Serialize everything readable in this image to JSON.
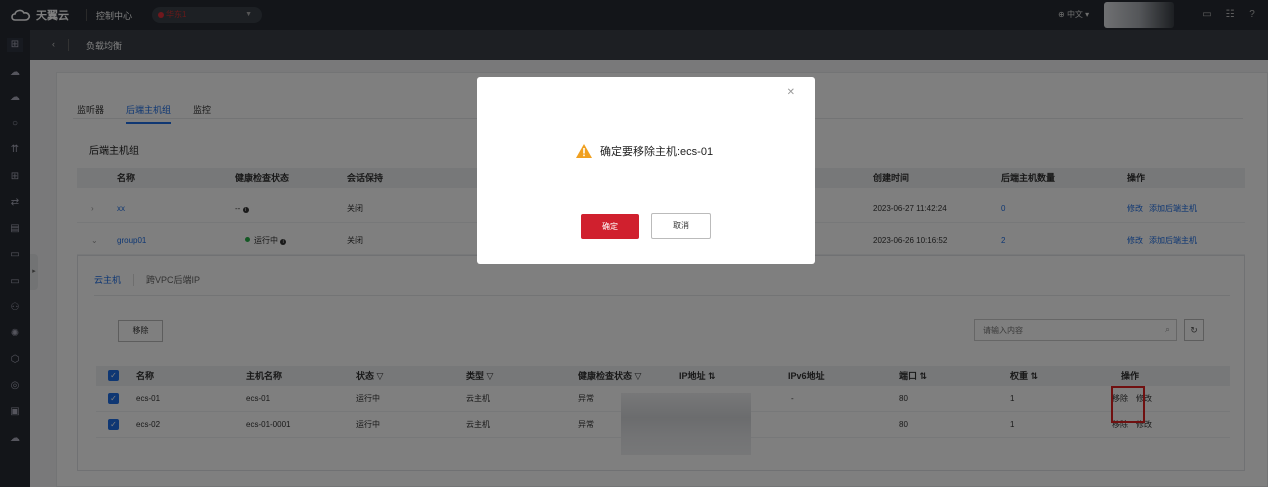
{
  "topbar": {
    "brand": "天翼云",
    "console": "控制中心",
    "region": "华东1",
    "lang": "中文"
  },
  "subbar": {
    "title": "负载均衡"
  },
  "tabs": [
    "监听器",
    "后端主机组",
    "监控"
  ],
  "section_title": "后端主机组",
  "group_table": {
    "headers": [
      "名称",
      "健康检查状态",
      "会话保持",
      "创建时间",
      "后端主机数量",
      "操作"
    ],
    "rows": [
      {
        "name": "xx",
        "health": "--",
        "session": "关闭",
        "created": "2023-06-27 11:42:24",
        "count": "0",
        "action1": "修改",
        "action2": "添加后端主机"
      },
      {
        "name": "group01",
        "health": "运行中",
        "session": "关闭",
        "created": "2023-06-26 10:16:52",
        "count": "2",
        "action1": "修改",
        "action2": "添加后端主机"
      }
    ]
  },
  "subtabs": [
    "云主机",
    "跨VPC后端IP"
  ],
  "remove_button": "移除",
  "search_placeholder": "请输入内容",
  "host_table": {
    "headers": [
      "名称",
      "主机名称",
      "状态",
      "类型",
      "健康检查状态",
      "IP地址",
      "IPv6地址",
      "端口",
      "权重",
      "操作"
    ],
    "rows": [
      {
        "name": "ecs-01",
        "host": "ecs-01",
        "state": "运行中",
        "type": "云主机",
        "health": "异常",
        "ipv6": "-",
        "port": "80",
        "weight": "1",
        "act1": "移除",
        "act2": "修改"
      },
      {
        "name": "ecs-02",
        "host": "ecs-01-0001",
        "state": "运行中",
        "type": "云主机",
        "health": "异常",
        "ipv6": "",
        "port": "80",
        "weight": "1",
        "act1": "移除",
        "act2": "修改"
      }
    ]
  },
  "modal": {
    "message": "确定要移除主机:ecs-01",
    "ok": "确定",
    "cancel": "取消"
  },
  "colors": {
    "accent": "#1e6ee6",
    "danger": "#d0202e",
    "warning": "#f0a020",
    "running": "#27b148"
  }
}
